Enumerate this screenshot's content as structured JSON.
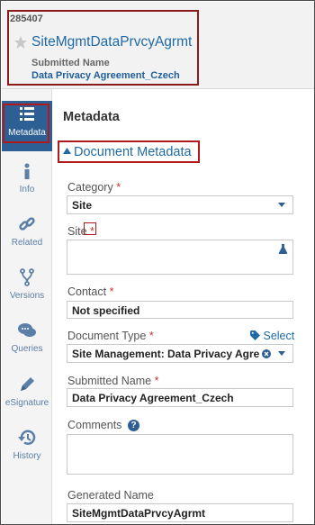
{
  "header": {
    "record_id": "285407",
    "title": "SiteMgmtDataPrvcyAgrmt",
    "submitted_name_label": "Submitted Name",
    "submitted_name_value": "Data Privacy Agreement_Czech"
  },
  "sidebar": {
    "items": [
      {
        "label": "Metadata",
        "icon": "list-icon",
        "active": true
      },
      {
        "label": "Info",
        "icon": "info-icon",
        "active": false
      },
      {
        "label": "Related",
        "icon": "link-icon",
        "active": false
      },
      {
        "label": "Versions",
        "icon": "branch-icon",
        "active": false
      },
      {
        "label": "Queries",
        "icon": "chat-icon",
        "active": false
      },
      {
        "label": "eSignature",
        "icon": "pen-icon",
        "active": false
      },
      {
        "label": "History",
        "icon": "history-icon",
        "active": false
      }
    ]
  },
  "main": {
    "title": "Metadata",
    "section_label": "Document Metadata",
    "fields": {
      "category": {
        "label": "Category",
        "required": "*",
        "value": "Site"
      },
      "site": {
        "label": "Site",
        "required": "*",
        "value": ""
      },
      "contact": {
        "label": "Contact",
        "required": "*",
        "value": "Not specified"
      },
      "document_type": {
        "label": "Document Type",
        "required": "*",
        "value": "Site Management: Data Privacy Agre",
        "select_link": "Select"
      },
      "submitted_name": {
        "label": "Submitted Name",
        "required": "*",
        "value": "Data Privacy Agreement_Czech"
      },
      "comments": {
        "label": "Comments",
        "value": ""
      },
      "generated_name": {
        "label": "Generated Name",
        "value": "SiteMgmtDataPrvcyAgrmt"
      }
    }
  },
  "colors": {
    "accent": "#1f6aa5",
    "active_sidebar": "#2d5f95",
    "highlight_box": "#b01a1a",
    "required": "#c0392b"
  }
}
